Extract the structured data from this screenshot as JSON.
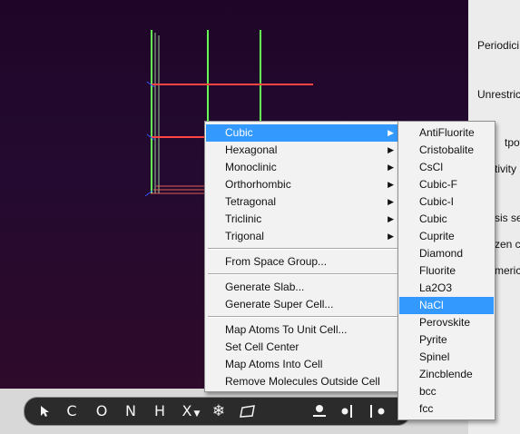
{
  "right_panel": {
    "labels": [
      "Periodici",
      "Unrestric",
      "tpoter",
      "tivity",
      "sis se",
      "zen c",
      "meric"
    ]
  },
  "menu": {
    "items": [
      {
        "label": "Cubic",
        "submenu": true,
        "selected": true
      },
      {
        "label": "Hexagonal",
        "submenu": true
      },
      {
        "label": "Monoclinic",
        "submenu": true
      },
      {
        "label": "Orthorhombic",
        "submenu": true
      },
      {
        "label": "Tetragonal",
        "submenu": true
      },
      {
        "label": "Triclinic",
        "submenu": true
      },
      {
        "label": "Trigonal",
        "submenu": true
      },
      {
        "label": "From Space Group..."
      },
      {
        "label": "Generate Slab..."
      },
      {
        "label": "Generate Super Cell..."
      },
      {
        "label": "Map Atoms To Unit Cell..."
      },
      {
        "label": "Set Cell Center"
      },
      {
        "label": "Map Atoms Into Cell"
      },
      {
        "label": "Remove Molecules Outside Cell"
      }
    ],
    "arrow": "▶"
  },
  "submenu": {
    "items": [
      "AntiFluorite",
      "Cristobalite",
      "CsCl",
      "Cubic-F",
      "Cubic-I",
      "Cubic",
      "Cuprite",
      "Diamond",
      "Fluorite",
      "La2O3",
      "NaCl",
      "Perovskite",
      "Pyrite",
      "Spinel",
      "Zincblende",
      "bcc",
      "fcc"
    ],
    "selected": "NaCl"
  },
  "toolbar": {
    "tools": [
      "C",
      "O",
      "N",
      "H",
      "X"
    ],
    "icons": [
      "select-arrow-icon",
      "element-picker-icon",
      "snowflake-icon",
      "plane-icon",
      "atom-tool-icon",
      "bond-tool-icon",
      "measure-tool-icon"
    ]
  },
  "colors": {
    "viewport_bg": "#240a30",
    "lattice_green": "#66ff55",
    "lattice_red": "#ff4444",
    "selection": "#3399ff",
    "menu_bg": "#f2f2f2"
  }
}
